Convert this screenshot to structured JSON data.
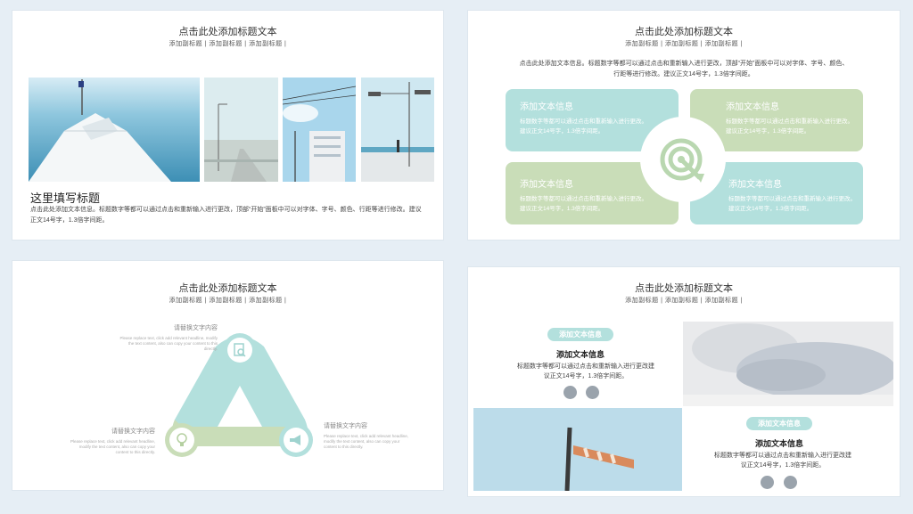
{
  "slide1": {
    "title": "点击此处添加标题文本",
    "subtitle": "添加副标题 | 添加副标题 | 添加副标题 |",
    "heading": "这里填写标题",
    "body": "点击此处添加文本信息。标题数字等都可以通过点击和重新输入进行更改，顶部“开始”面板中可以对字体、字号、颜色、行距等进行修改。建议正文14号字，1.3倍字间距。"
  },
  "slide2": {
    "title": "点击此处添加标题文本",
    "subtitle": "添加副标题 | 添加副标题 | 添加副标题 |",
    "intro": "点击此处添加文本信息。标题数字等都可以通过点击和重新输入进行更改，顶部“开始”面板中可以对字体、字号、颜色、行距等进行修改。建议正文14号字，1.3倍字间距。",
    "cards": [
      {
        "heading": "添加文本信息",
        "body": "标题数字等都可以通过点击和重新输入进行更改。建议正文14号字，1.3倍字间距。"
      },
      {
        "heading": "添加文本信息",
        "body": "标题数字等都可以通过点击和重新输入进行更改。建议正文14号字，1.3倍字间距。"
      },
      {
        "heading": "添加文本信息",
        "body": "标题数字等都可以通过点击和重新输入进行更改。建议正文14号字，1.3倍字间距。"
      },
      {
        "heading": "添加文本信息",
        "body": "标题数字等都可以通过点击和重新输入进行更改。建议正文14号字，1.3倍字间距。"
      }
    ]
  },
  "slide3": {
    "title": "点击此处添加标题文本",
    "subtitle": "添加副标题 | 添加副标题 | 添加副标题 |",
    "labels": [
      {
        "heading": "请替换文字内容",
        "body": "Please replace text, click add relevant headline, modify the text content, also can copy your content to this directly."
      },
      {
        "heading": "请替换文字内容",
        "body": "Please replace text, click add relevant headline, modify the text content, also can copy your content to this directly."
      },
      {
        "heading": "请替换文字内容",
        "body": "Please replace text, click add relevant headline, modify the text content, also can copy your content to this directly."
      }
    ]
  },
  "slide4": {
    "title": "点击此处添加标题文本",
    "subtitle": "添加副标题 | 添加副标题 | 添加副标题 |",
    "blocks": [
      {
        "pill": "添加文本信息",
        "heading": "添加文本信息",
        "body": "标题数字等都可以通过点击和重新输入进行更改建议正文14号字，1.3倍字间距。"
      },
      {
        "pill": "添加文本信息",
        "heading": "添加文本信息",
        "body": "标题数字等都可以通过点击和重新输入进行更改建议正文14号字，1.3倍字间距。"
      }
    ]
  },
  "colors": {
    "teal": "#b3e0dd",
    "sage": "#c9ddb8",
    "background": "#e6eef5"
  },
  "icons": [
    "target-icon",
    "document-search-icon",
    "lightbulb-icon",
    "megaphone-icon",
    "wechat-icon",
    "microphone-icon",
    "database-icon",
    "share-icon"
  ]
}
